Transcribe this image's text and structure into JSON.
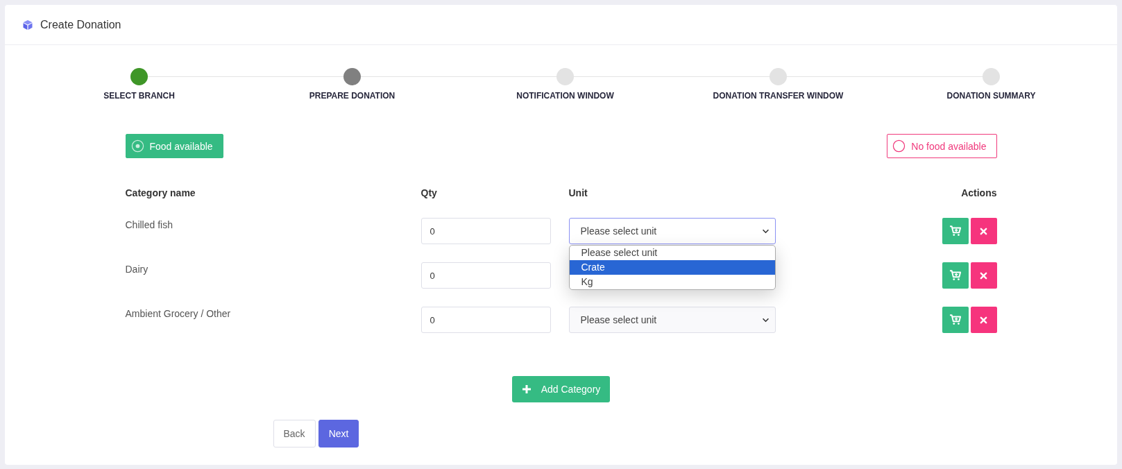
{
  "header": {
    "title": "Create Donation"
  },
  "steps": [
    {
      "label": "SELECT BRANCH",
      "completed": true,
      "selected": false
    },
    {
      "label": "PREPARE DONATION",
      "completed": false,
      "selected": true
    },
    {
      "label": "NOTIFICATION WINDOW",
      "completed": false,
      "selected": false
    },
    {
      "label": "DONATION TRANSFER WINDOW",
      "completed": false,
      "selected": false
    },
    {
      "label": "DONATION SUMMARY",
      "completed": false,
      "selected": false
    }
  ],
  "availability": [
    {
      "label": "Food available",
      "selected": true
    },
    {
      "label": "No food available",
      "selected": false
    }
  ],
  "table": {
    "columns": [
      "Category name",
      "Qty",
      "Unit",
      "Actions"
    ],
    "rows": [
      {
        "category": "Chilled fish",
        "qty": "0",
        "unit": "Please select unit",
        "focused": true,
        "dropdown": [
          {
            "label": "Please select unit",
            "selected": false
          },
          {
            "label": "Crate",
            "selected": true
          },
          {
            "label": "Kg",
            "selected": false
          }
        ]
      },
      {
        "category": "Dairy",
        "qty": "0"
      },
      {
        "category": "Ambient Grocery / Other",
        "qty": "0",
        "unit": "Please select unit",
        "focused": false
      }
    ]
  },
  "add_button": "Add Category",
  "nav": [
    {
      "label": "Back",
      "kind": "secondary"
    },
    {
      "label": "Next",
      "kind": "primary"
    }
  ]
}
